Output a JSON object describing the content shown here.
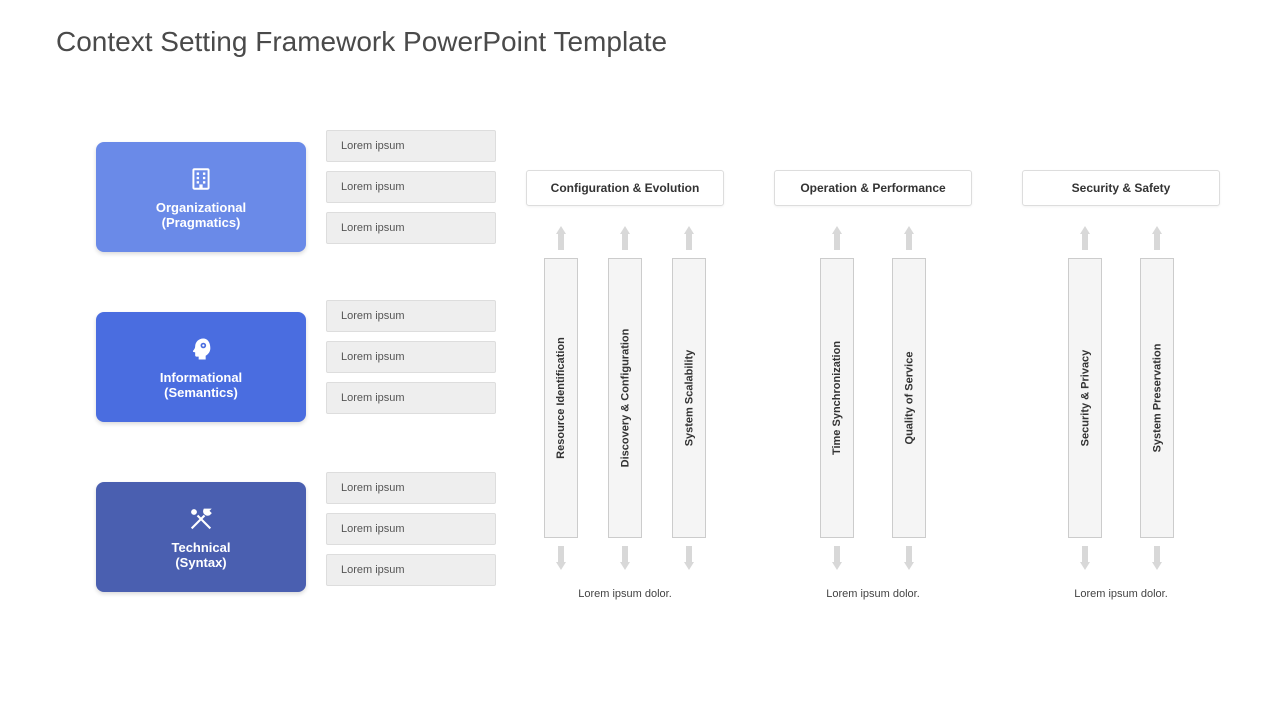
{
  "title": "Context Setting Framework PowerPoint Template",
  "layers": [
    {
      "name": "Organizational",
      "sub": "(Pragmatics)",
      "bullets": [
        "Lorem ipsum",
        "Lorem ipsum",
        "Lorem ipsum"
      ]
    },
    {
      "name": "Informational",
      "sub": "(Semantics)",
      "bullets": [
        "Lorem ipsum",
        "Lorem ipsum",
        "Lorem ipsum"
      ]
    },
    {
      "name": "Technical",
      "sub": "(Syntax)",
      "bullets": [
        "Lorem ipsum",
        "Lorem ipsum",
        "Lorem ipsum"
      ]
    }
  ],
  "groups": [
    {
      "header": "Configuration & Evolution",
      "caption": "Lorem ipsum dolor.",
      "cols": [
        "Resource Identification",
        "Discovery & Configuration",
        "System Scalability"
      ]
    },
    {
      "header": "Operation & Performance",
      "caption": "Lorem ipsum dolor.",
      "cols": [
        "Time Synchronization",
        "Quality of Service"
      ]
    },
    {
      "header": "Security & Safety",
      "caption": "Lorem ipsum dolor.",
      "cols": [
        "Security & Privacy",
        "System Preservation"
      ]
    }
  ]
}
